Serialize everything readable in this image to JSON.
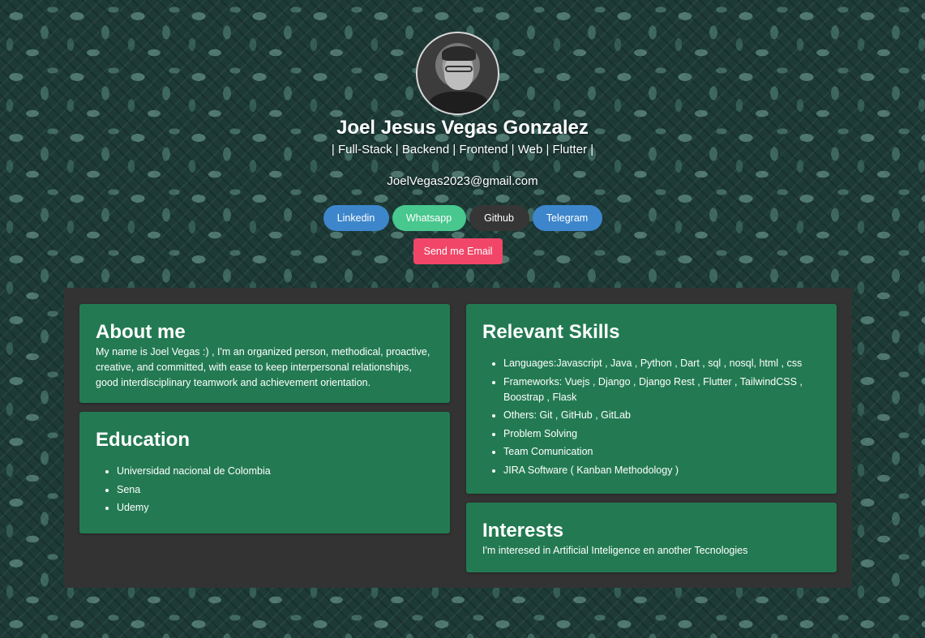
{
  "profile": {
    "name": "Joel Jesus Vegas Gonzalez",
    "roles": "| Full-Stack | Backend | Frontend | Web | Flutter |",
    "email": "JoelVegas2023@gmail.com"
  },
  "socials": {
    "linkedin": "Linkedin",
    "whatsapp": "Whatsapp",
    "github": "Github",
    "telegram": "Telegram"
  },
  "send_email_label": "Send me Email",
  "about": {
    "title": "About me",
    "text": "My name is Joel Vegas :) , I'm an organized person, methodical, proactive, creative, and committed, with ease to keep interpersonal relationships, good interdisciplinary teamwork and achievement orientation."
  },
  "education": {
    "title": "Education",
    "items": [
      "Universidad nacional de Colombia",
      "Sena",
      "Udemy"
    ]
  },
  "skills": {
    "title": "Relevant Skills",
    "items": [
      "Languages:Javascript , Java , Python , Dart , sql , nosql, html , css",
      "Frameworks: Vuejs , Django , Django Rest , Flutter , TailwindCSS , Boostrap , Flask",
      "Others: Git , GitHub , GitLab",
      "Problem Solving",
      "Team Comunication",
      "JIRA Software ( Kanban Methodology )"
    ]
  },
  "interests": {
    "title": "Interests",
    "text": "I'm interesed in Artificial Inteligence en another Tecnologies"
  },
  "colors": {
    "card_green": "#237a52",
    "panel_dark": "#333333",
    "linkedin_blue": "#3d86cc",
    "whatsapp_green": "#48c78e",
    "github_dark": "#363636",
    "email_red": "#f14668"
  }
}
